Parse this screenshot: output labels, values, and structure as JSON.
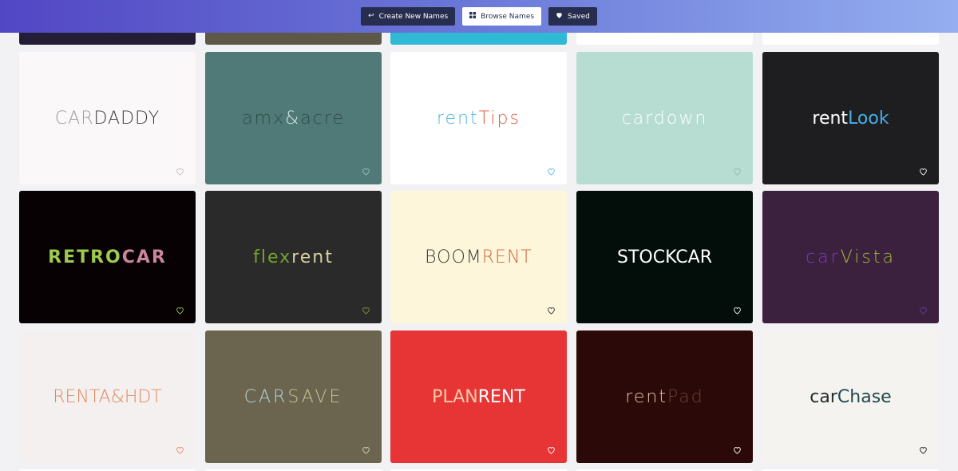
{
  "nav": {
    "create_label": "Create New Names",
    "browse_label": "Browse Names",
    "saved_label": "Saved",
    "create_icon": "return-arrow-icon",
    "browse_icon": "grid-icon",
    "saved_icon": "heart-icon"
  },
  "colors": {
    "header_gradient": [
      "#5246c4",
      "#6b79d8",
      "#94aef0"
    ],
    "page_bg": "#f2f2f4"
  },
  "top_partial_cards": [
    {
      "bg": "#231d35"
    },
    {
      "bg": "#5d5847"
    },
    {
      "bg": "#2fb9d5"
    },
    {
      "bg": "#ffffff"
    },
    {
      "bg": "#ffffff"
    }
  ],
  "cards": [
    {
      "name": "cardaddy",
      "bg": "#faf8f8",
      "heart": "#c3bcbc",
      "parts": [
        {
          "t": "CAR",
          "c": "#9d9d9d"
        },
        {
          "t": "DADDY",
          "c": "#3d3d3d"
        }
      ],
      "weight": "300",
      "spacing": "1px"
    },
    {
      "name": "amxacre",
      "bg": "#4f7a77",
      "heart": "#9fc1bc",
      "parts": [
        {
          "t": "amx",
          "c": "#2f4c4a"
        },
        {
          "t": "&",
          "c": "#d7eae6"
        },
        {
          "t": "acre",
          "c": "#2f4c4a"
        }
      ],
      "weight": "300",
      "spacing": "2px"
    },
    {
      "name": "renttips",
      "bg": "#ffffff",
      "heart": "#5ab6e8",
      "parts": [
        {
          "t": "rent",
          "c": "#4eb1e3"
        },
        {
          "t": "Tips",
          "c": "#e05a34"
        }
      ],
      "weight": "300",
      "spacing": "2px"
    },
    {
      "name": "cardown",
      "bg": "#b7ddd3",
      "heart": "#8fb8ad",
      "parts": [
        {
          "t": "cardown",
          "c": "#ffffff"
        }
      ],
      "weight": "300",
      "spacing": "2px"
    },
    {
      "name": "rentlook",
      "bg": "#1e1e20",
      "heart": "#ffffff",
      "parts": [
        {
          "t": "rent",
          "c": "#ffffff"
        },
        {
          "t": "Look",
          "c": "#45aee8"
        }
      ],
      "weight": "400",
      "spacing": "0px"
    },
    {
      "name": "retrocar",
      "bg": "#070103",
      "heart": "#9cc84f",
      "parts": [
        {
          "t": "RETRO",
          "c": "#9ccb4e"
        },
        {
          "t": "CAR",
          "c": "#c9869d"
        }
      ],
      "weight": "700",
      "spacing": "2px"
    },
    {
      "name": "flexrent",
      "bg": "#2a2a2a",
      "heart": "#7a9a3e",
      "parts": [
        {
          "t": "flex",
          "c": "#75a22f"
        },
        {
          "t": "rent",
          "c": "#d8d0a0"
        }
      ],
      "weight": "400",
      "spacing": "2px"
    },
    {
      "name": "boomrent",
      "bg": "#fdf6da",
      "heart": "#2b2b2b",
      "parts": [
        {
          "t": "BOOM",
          "c": "#3b3b3b"
        },
        {
          "t": "RENT",
          "c": "#d1653c"
        }
      ],
      "weight": "300",
      "spacing": "1px"
    },
    {
      "name": "stockcar",
      "bg": "#030e0b",
      "heart": "#ffffff",
      "parts": [
        {
          "t": "STOCKCAR",
          "c": "#ffffff"
        }
      ],
      "weight": "400",
      "spacing": "0px"
    },
    {
      "name": "carvista",
      "bg": "#3b213d",
      "heart": "#6a3aa8",
      "parts": [
        {
          "t": "car",
          "c": "#7a3cc0"
        },
        {
          "t": "Vista",
          "c": "#a6b83a"
        }
      ],
      "weight": "300",
      "spacing": "3px"
    },
    {
      "name": "rentahdt",
      "bg": "#f4f0ef",
      "heart": "#e38a64",
      "parts": [
        {
          "t": "RENTA&HDT",
          "c": "#e0885f"
        }
      ],
      "weight": "300",
      "spacing": "0px"
    },
    {
      "name": "carsave",
      "bg": "#6b6550",
      "heart": "#d8d2c0",
      "parts": [
        {
          "t": "CAR",
          "c": "#b5d2d8"
        },
        {
          "t": "SAVE",
          "c": "#c8c193"
        }
      ],
      "weight": "300",
      "spacing": "3px"
    },
    {
      "name": "planrent",
      "bg": "#e73536",
      "heart": "#ffffff",
      "parts": [
        {
          "t": "PLAN",
          "c": "#f7c9a8"
        },
        {
          "t": "RENT",
          "c": "#ffffff"
        }
      ],
      "weight": "400",
      "spacing": "0px"
    },
    {
      "name": "rentpad",
      "bg": "#2c0909",
      "heart": "#ffffff",
      "parts": [
        {
          "t": "rent",
          "c": "#e8c39a"
        },
        {
          "t": "Pad",
          "c": "#6b3f32"
        }
      ],
      "weight": "300",
      "spacing": "2px"
    },
    {
      "name": "carchase",
      "bg": "#f5f3f0",
      "heart": "#1a1a1a",
      "parts": [
        {
          "t": "car",
          "c": "#232d2d"
        },
        {
          "t": "Chase",
          "c": "#1f4a4c"
        }
      ],
      "weight": "400",
      "spacing": "0px"
    }
  ]
}
